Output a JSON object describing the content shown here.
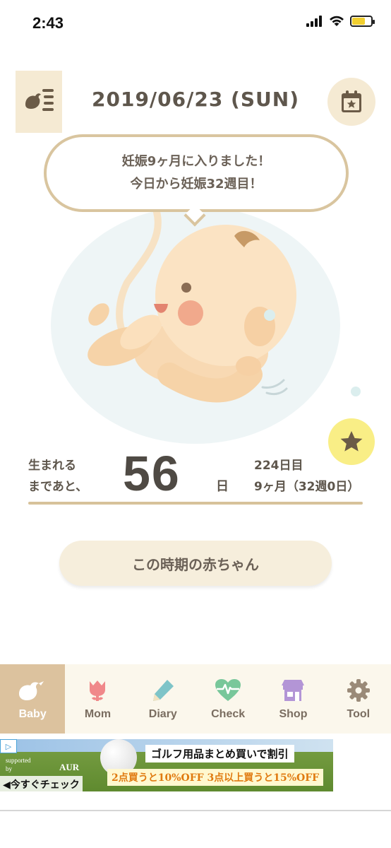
{
  "status_bar": {
    "time": "2:43",
    "battery_level": 0.65
  },
  "header": {
    "date": "2019/06/23 (SUN)"
  },
  "bubble": {
    "line1": "妊娠9ヶ月に入りました！",
    "line2": "今日から妊娠32週目！"
  },
  "countdown": {
    "left_line1": "生まれる",
    "left_line2": "まであと、",
    "days": "56",
    "unit": "日",
    "right_line1": "224日目",
    "right_line2": "9ヶ月（32週0日）"
  },
  "baby_button_label": "この時期の赤ちゃん",
  "tabs": [
    {
      "label": "Baby",
      "icon": "bird-icon",
      "color": "#ffffff"
    },
    {
      "label": "Mom",
      "icon": "tulip-icon",
      "color": "#f0888a"
    },
    {
      "label": "Diary",
      "icon": "pencil-icon",
      "color": "#7ec4c8"
    },
    {
      "label": "Check",
      "icon": "heart-pulse-icon",
      "color": "#78c79a"
    },
    {
      "label": "Shop",
      "icon": "shop-icon",
      "color": "#b395d6"
    },
    {
      "label": "Tool",
      "icon": "gear-icon",
      "color": "#9a8a78"
    }
  ],
  "ad": {
    "supported_by": "supported\nby",
    "brand": "AUR",
    "headline": "ゴルフ用品まとめ買いで割引",
    "offer": "2点買うと10%OFF  3点以上買うと15%OFF",
    "cta": "◀今すぐチェック"
  },
  "colors": {
    "accent_beige": "#d9c59f",
    "button_bg": "#f6eedc",
    "star_button": "#f9ee86",
    "active_tab": "#dcc29e"
  }
}
